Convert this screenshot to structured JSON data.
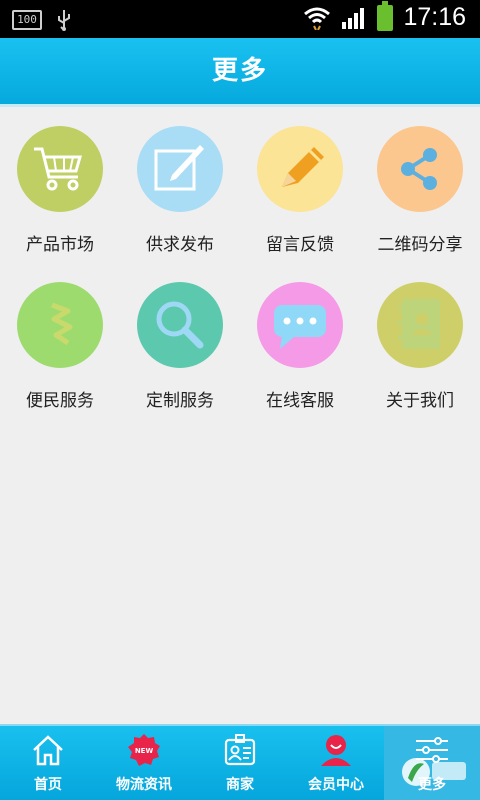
{
  "status_bar": {
    "battery_level_label": "100",
    "time": "17:16"
  },
  "header": {
    "title": "更多"
  },
  "grid": {
    "items": [
      {
        "label": "产品市场",
        "icon": "cart-icon",
        "color": "#bfcf63"
      },
      {
        "label": "供求发布",
        "icon": "edit-icon",
        "color": "#a9dcf5"
      },
      {
        "label": "留言反馈",
        "icon": "pencil-icon",
        "color": "#fbe496"
      },
      {
        "label": "二维码分享",
        "icon": "share-icon",
        "color": "#fbc78f"
      },
      {
        "label": "便民服务",
        "icon": "service-icon",
        "color": "#9edb6f"
      },
      {
        "label": "定制服务",
        "icon": "search-icon",
        "color": "#5cc9ae"
      },
      {
        "label": "在线客服",
        "icon": "chat-icon",
        "color": "#f59ae6"
      },
      {
        "label": "关于我们",
        "icon": "contact-book-icon",
        "color": "#cfcf6a"
      }
    ]
  },
  "bottom_nav": {
    "items": [
      {
        "label": "首页",
        "icon": "home-icon"
      },
      {
        "label": "物流资讯",
        "icon": "news-badge-icon"
      },
      {
        "label": "商家",
        "icon": "merchant-icon"
      },
      {
        "label": "会员中心",
        "icon": "member-icon"
      },
      {
        "label": "更多",
        "icon": "settings-sliders-icon",
        "active": true
      }
    ]
  }
}
